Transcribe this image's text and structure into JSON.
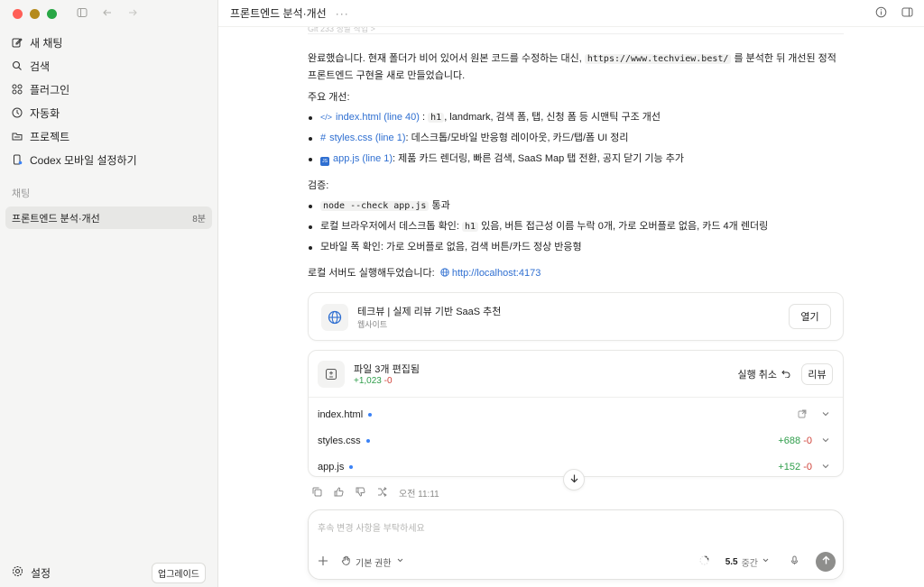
{
  "window": {
    "title": "프론트엔드 분석·개선",
    "more_label": "···",
    "traffic_colors": [
      "#ff5f57",
      "#b58a1b",
      "#28a745"
    ]
  },
  "sidebar": {
    "nav": [
      {
        "label": "새 채팅",
        "icon": "compose-icon"
      },
      {
        "label": "검색",
        "icon": "search-icon"
      },
      {
        "label": "플러그인",
        "icon": "plugins-icon"
      },
      {
        "label": "자동화",
        "icon": "clock-icon"
      },
      {
        "label": "프로젝트",
        "icon": "folder-icon"
      },
      {
        "label": "Codex 모바일 설정하기",
        "icon": "mobile-icon"
      }
    ],
    "section_label": "채팅",
    "chats": [
      {
        "title": "프론트엔드 분석·개선",
        "time": "8분"
      }
    ],
    "settings_label": "설정",
    "upgrade_label": "업그레이드"
  },
  "message": {
    "faded_top": "Git 233 정말 작업 >",
    "intro_1": "완료했습니다. 현재 폴더가 비어 있어서 원본 코드를 수정하는 대신,",
    "intro_code": "https://www.techview.best/",
    "intro_2": "를 분석한 뒤 개선된 정적",
    "intro_line2": "프론트엔드 구현을 새로 만들었습니다.",
    "improvements_heading": "주요 개선:",
    "improvements": [
      {
        "icon": "code-file-icon",
        "glyph": "</>",
        "link": "index.html (line 40)",
        "pre": ":",
        "code": "h1",
        "rest": ", landmark, 검색 폼, 탭, 신청 폼 등 시맨틱 구조 개선"
      },
      {
        "icon": "hash-file-icon",
        "glyph": "#",
        "link": "styles.css (line 1)",
        "pre": ": 데스크톱/모바일 반응형 레이아웃, 카드/탭/폼 UI 정리",
        "code": "",
        "rest": ""
      },
      {
        "icon": "js-file-icon",
        "glyph": "JS",
        "link": "app.js (line 1)",
        "pre": ": 제품 카드 렌더링, 빠른 검색, SaaS Map 탭 전환, 공지 닫기 기능 추가",
        "code": "",
        "rest": ""
      }
    ],
    "verify_heading": "검증:",
    "verify": [
      {
        "code": "node --check app.js",
        "pre": "",
        "rest": " 통과"
      },
      {
        "pre": "로컬 브라우저에서 데스크톱 확인:",
        "code": "h1",
        "rest": " 있음, 버튼 접근성 이름 누락 0개, 가로 오버플로 없음, 카드 4개 렌더링"
      },
      {
        "pre": "모바일 폭 확인: 가로 오버플로 없음, 검색 버튼/카드 정상 반응형",
        "code": "",
        "rest": ""
      }
    ],
    "server_text": "로컬 서버도 실행해두었습니다:",
    "server_link": "http://localhost:4173"
  },
  "website_card": {
    "title": "테크뷰 | 실제 리뷰 기반 SaaS 추천",
    "subtitle": "웹사이트",
    "open_label": "열기"
  },
  "edits_card": {
    "title": "파일 3개 편집됨",
    "added": "+1,023",
    "removed": "-0",
    "undo_label": "실행 취소",
    "review_label": "리뷰",
    "files": [
      {
        "name": "index.html",
        "added": "",
        "removed": ""
      },
      {
        "name": "styles.css",
        "added": "+688",
        "removed": "-0"
      },
      {
        "name": "app.js",
        "added": "+152",
        "removed": "-0"
      }
    ]
  },
  "message_actions": {
    "time": "오전 11:11"
  },
  "composer": {
    "placeholder": "후속 변경 사항을 부탁하세요",
    "permission_label": "기본 권한",
    "model_label": "5.5",
    "effort_label": "중간"
  },
  "colors": {
    "accent": "#2f6fd1",
    "added": "#2e9d4a",
    "removed": "#d0433a"
  }
}
